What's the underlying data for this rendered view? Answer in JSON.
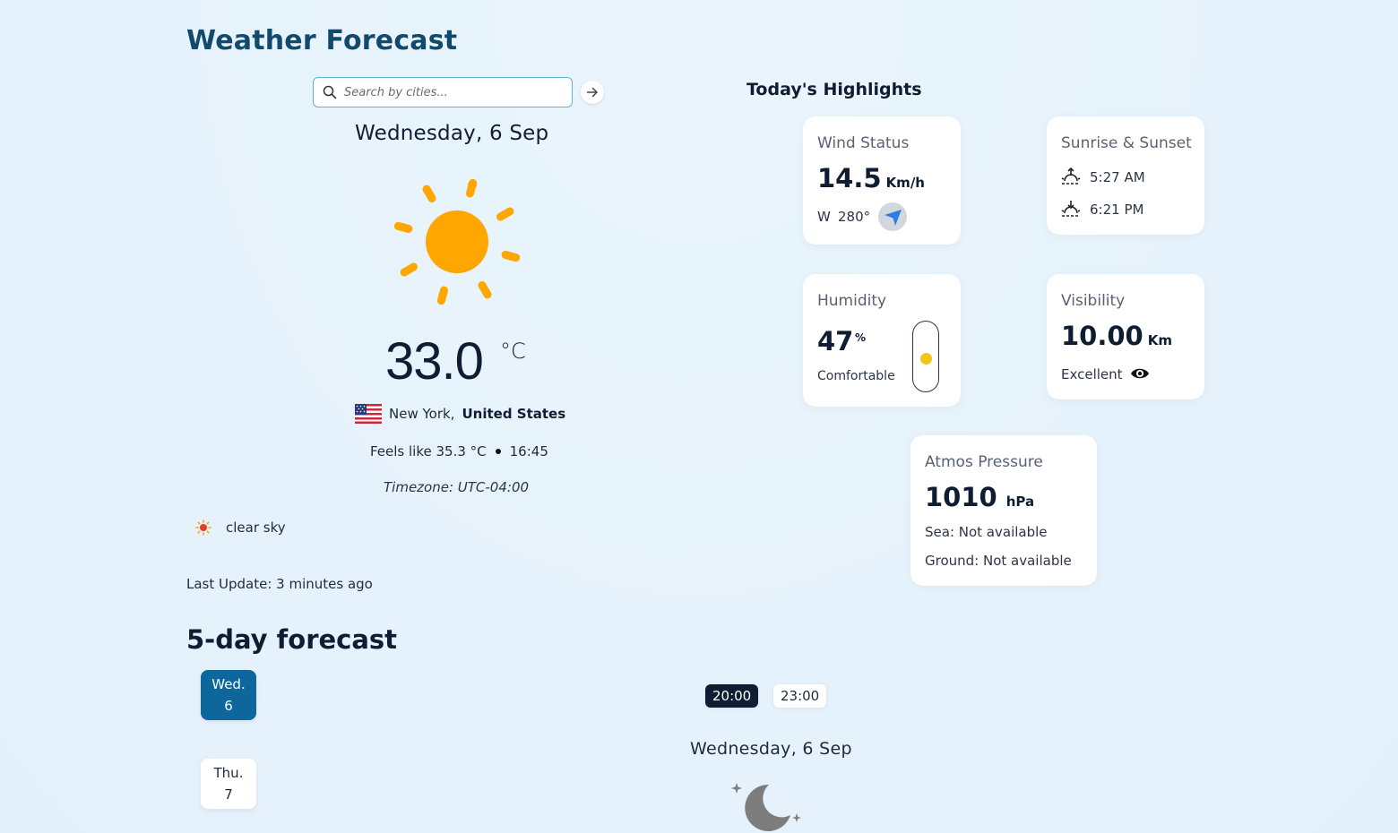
{
  "app": {
    "title": "Weather Forecast"
  },
  "search": {
    "placeholder": "Search by cities..."
  },
  "current": {
    "date": "Wednesday, 6 Sep",
    "temperature": "33.0",
    "unit": "°C",
    "city": "New York,",
    "country": "United States",
    "feels_like": "Feels like 35.3 °C",
    "time": "16:45",
    "timezone": "Timezone:  UTC-04:00",
    "condition": "clear sky",
    "last_update": "Last Update: 3 minutes ago"
  },
  "forecast": {
    "title": "5-day forecast",
    "days": [
      {
        "name": "Wed.",
        "num": "6",
        "active": true
      },
      {
        "name": "Thu.",
        "num": "7",
        "active": false
      }
    ],
    "times": [
      {
        "label": "20:00",
        "active": true
      },
      {
        "label": "23:00",
        "active": false
      }
    ],
    "selected_date": "Wednesday, 6 Sep"
  },
  "highlights": {
    "title": "Today's Highlights",
    "wind": {
      "title": "Wind Status",
      "value": "14.5",
      "unit": "Km/h",
      "dir": "W",
      "deg": "280°"
    },
    "sun": {
      "title": "Sunrise & Sunset",
      "sunrise": "5:27 AM",
      "sunset": "6:21 PM"
    },
    "humidity": {
      "title": "Humidity",
      "value": "47",
      "unit": "%",
      "desc": "Comfortable",
      "level": 0.47
    },
    "visibility": {
      "title": "Visibility",
      "value": "10.00",
      "unit": "Km",
      "desc": "Excellent"
    },
    "pressure": {
      "title": "Atmos Pressure",
      "value": "1010",
      "unit": "hPa",
      "sea": "Sea: Not available",
      "ground": "Ground: Not available"
    }
  },
  "colors": {
    "accent": "#0e679c",
    "sun": "#ffa600",
    "title": "#124a6e",
    "dark_chip": "#0f1d33"
  }
}
